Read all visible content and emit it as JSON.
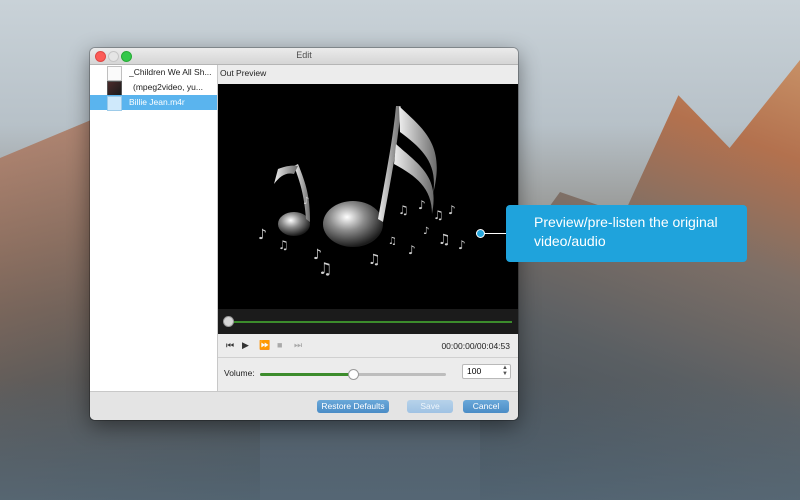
{
  "window": {
    "title": "Edit"
  },
  "sidebar": {
    "items": [
      {
        "label": "_Children We All Sh..."
      },
      {
        "label": "(mpeg2video,  yu..."
      },
      {
        "label": "Billie Jean.m4r"
      }
    ]
  },
  "main": {
    "preview_label": "Out Preview",
    "time_readout": "00:00:00/00:04:53",
    "progress_fraction": 0.0,
    "volume": {
      "label": "Volume:",
      "value": "100",
      "fraction": 0.5
    }
  },
  "footer": {
    "restore_label": "Restore Defaults",
    "save_label": "Save",
    "cancel_label": "Cancel"
  },
  "callout": {
    "text": "Preview/pre-listen the original video/audio"
  },
  "colors": {
    "accent": "#1fa3dc",
    "selection": "#5ab4ee",
    "progress": "#3c8c2c"
  }
}
